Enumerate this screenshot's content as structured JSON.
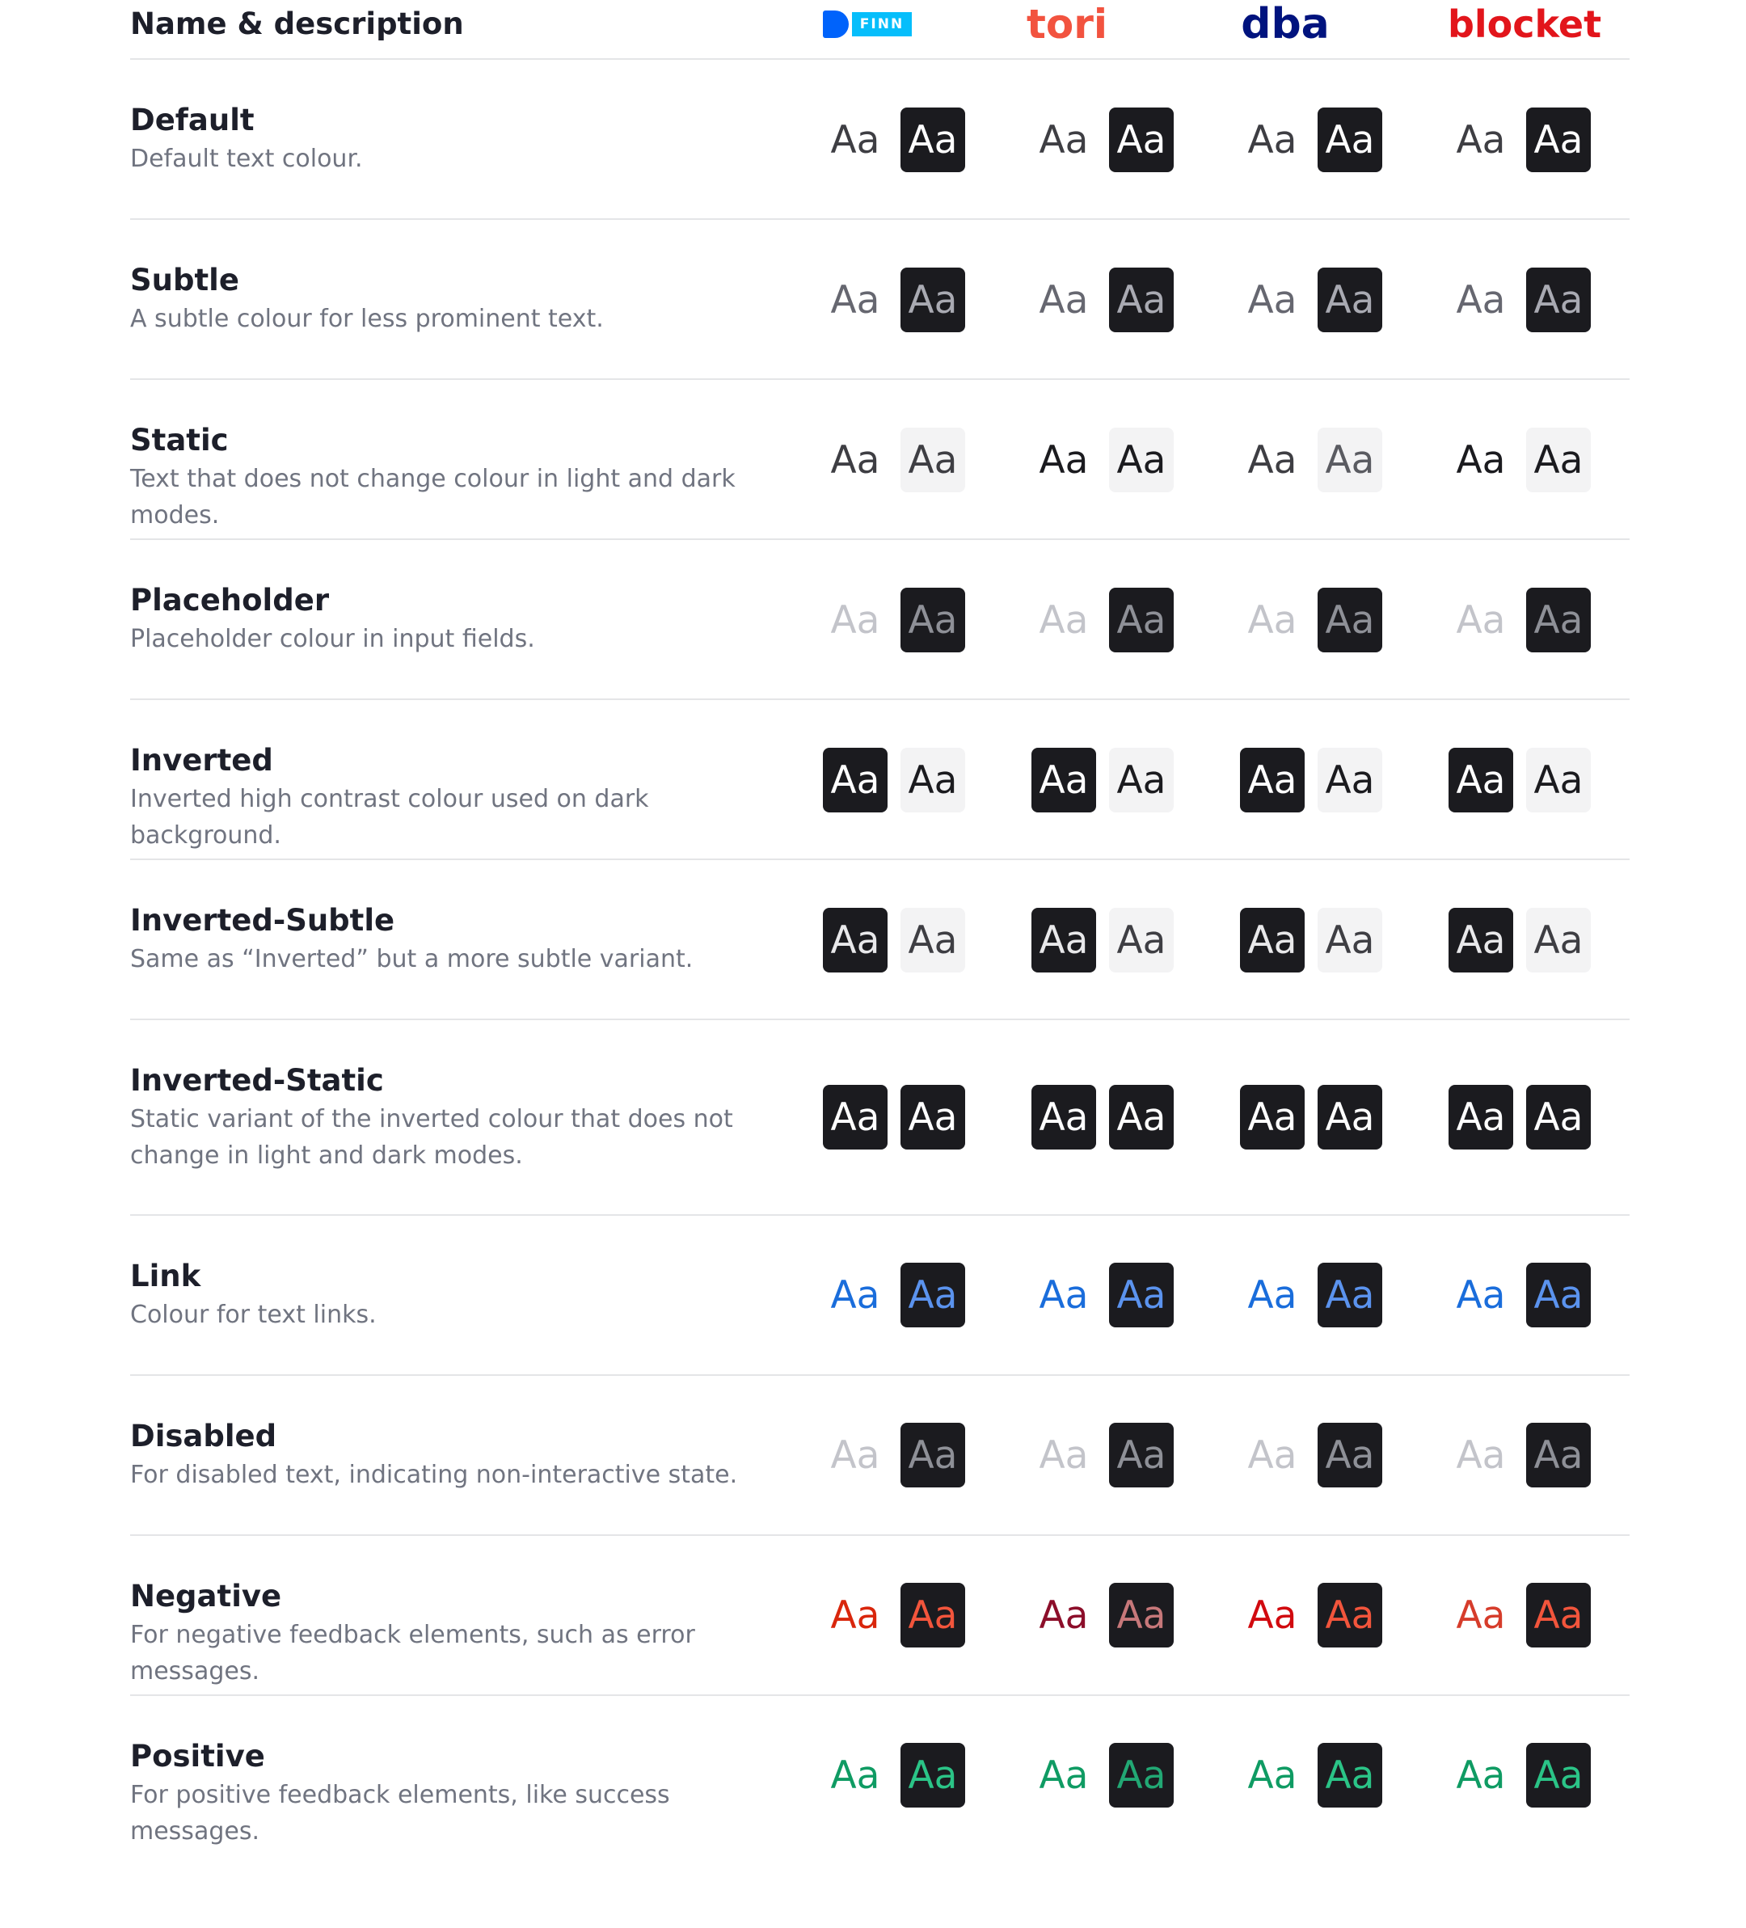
{
  "header": {
    "title": "Name & description"
  },
  "brands": [
    {
      "key": "finn",
      "label": "FINN"
    },
    {
      "key": "tori",
      "label": "tori"
    },
    {
      "key": "dba",
      "label": "dba"
    },
    {
      "key": "blocket",
      "label": "blocket"
    }
  ],
  "sample_text": "Aa",
  "tokens": [
    {
      "name": "Default",
      "description": "Default text colour.",
      "light": {
        "bg": "transparent",
        "fg": [
          "#3e3e43",
          "#3e3e43",
          "#3e3e43",
          "#3e3e43"
        ]
      },
      "dark": {
        "bg": "#1b1b1f",
        "fg": [
          "#ffffff",
          "#ffffff",
          "#ffffff",
          "#ffffff"
        ]
      }
    },
    {
      "name": "Subtle",
      "description": "A subtle colour for less prominent text.",
      "light": {
        "bg": "transparent",
        "fg": [
          "#666770",
          "#666770",
          "#666770",
          "#666770"
        ]
      },
      "dark": {
        "bg": "#1b1b1f",
        "fg": [
          "#a9aab2",
          "#a9aab2",
          "#a9aab2",
          "#a9aab2"
        ]
      }
    },
    {
      "name": "Static",
      "description": "Text that does not change colour in light and dark modes.",
      "light": {
        "bg": "transparent",
        "fg": [
          "#3e3e43",
          "#1b1b1f",
          "#3e3e43",
          "#1b1b1f"
        ]
      },
      "dark": {
        "bg": "#f3f3f4",
        "fg": [
          "#3e3e43",
          "#1b1b1f",
          "#5a5b61",
          "#1b1b1f"
        ]
      }
    },
    {
      "name": "Placeholder",
      "description": "Placeholder colour in input fields.",
      "light": {
        "bg": "transparent",
        "fg": [
          "#c3c4ca",
          "#c3c4ca",
          "#c3c4ca",
          "#c3c4ca"
        ]
      },
      "dark": {
        "bg": "#1b1b1f",
        "fg": [
          "#8e9097",
          "#8e9097",
          "#8e9097",
          "#8e9097"
        ]
      }
    },
    {
      "name": "Inverted",
      "description": "Inverted high contrast colour used on dark background.",
      "light": {
        "bg": "#1b1b1f",
        "fg": [
          "#ffffff",
          "#ffffff",
          "#ffffff",
          "#ffffff"
        ]
      },
      "dark": {
        "bg": "#f3f3f4",
        "fg": [
          "#1b1b1f",
          "#1b1b1f",
          "#1b1b1f",
          "#1b1b1f"
        ]
      }
    },
    {
      "name": "Inverted-Subtle",
      "description": "Same as “Inverted” but a more subtle variant.",
      "light": {
        "bg": "#1b1b1f",
        "fg": [
          "#e8e8ea",
          "#e8e8ea",
          "#e8e8ea",
          "#e8e8ea"
        ]
      },
      "dark": {
        "bg": "#f3f3f4",
        "fg": [
          "#3e3e43",
          "#3e3e43",
          "#3e3e43",
          "#3e3e43"
        ]
      }
    },
    {
      "name": "Inverted-Static",
      "description": "Static variant of the inverted colour that does not change in light and dark modes.",
      "light": {
        "bg": "#1b1b1f",
        "fg": [
          "#ffffff",
          "#ffffff",
          "#ffffff",
          "#ffffff"
        ]
      },
      "dark": {
        "bg": "#1b1b1f",
        "fg": [
          "#ffffff",
          "#ffffff",
          "#ffffff",
          "#ffffff"
        ]
      }
    },
    {
      "name": "Link",
      "description": "Colour for text links.",
      "light": {
        "bg": "transparent",
        "fg": [
          "#1a6ddb",
          "#1a6ddb",
          "#1a6ddb",
          "#1a6ddb"
        ]
      },
      "dark": {
        "bg": "#1b1b1f",
        "fg": [
          "#5b93ee",
          "#5b93ee",
          "#5b93ee",
          "#5b93ee"
        ]
      }
    },
    {
      "name": "Disabled",
      "description": "For disabled text, indicating non-interactive state.",
      "light": {
        "bg": "transparent",
        "fg": [
          "#c3c4ca",
          "#c3c4ca",
          "#c3c4ca",
          "#c3c4ca"
        ]
      },
      "dark": {
        "bg": "#1b1b1f",
        "fg": [
          "#8e9097",
          "#8e9097",
          "#8e9097",
          "#8e9097"
        ]
      }
    },
    {
      "name": "Negative",
      "description": "For negative feedback elements, such as error messages.",
      "light": {
        "bg": "transparent",
        "fg": [
          "#d9260c",
          "#8c0e2a",
          "#d10a0f",
          "#d63c2b"
        ]
      },
      "dark": {
        "bg": "#1b1b1f",
        "fg": [
          "#f2553c",
          "#c7787a",
          "#f2553c",
          "#f2553c"
        ]
      }
    },
    {
      "name": "Positive",
      "description": "For positive feedback elements, like success messages.",
      "light": {
        "bg": "transparent",
        "fg": [
          "#0f9b63",
          "#0f9b63",
          "#0f9b63",
          "#0f9b63"
        ]
      },
      "dark": {
        "bg": "#1b1b1f",
        "fg": [
          "#2bc487",
          "#22a874",
          "#2bc487",
          "#2bc487"
        ]
      }
    }
  ]
}
